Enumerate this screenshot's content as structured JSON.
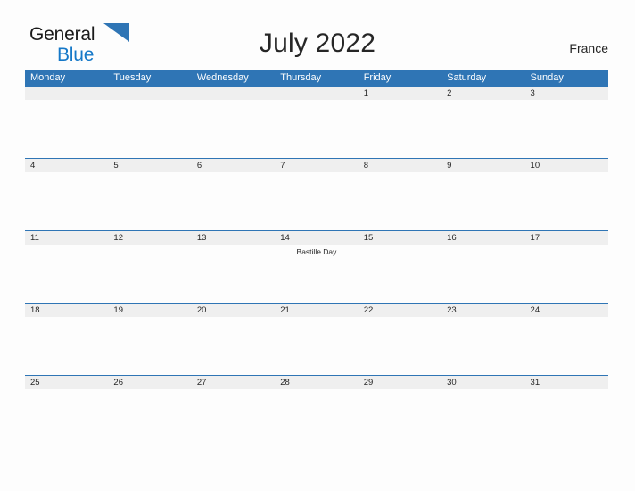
{
  "brand": {
    "word1": "General",
    "word2": "Blue",
    "flag_icon": "blue-triangle-flag-icon",
    "word1_color": "#1a1a1a",
    "word2_color": "#1578c8",
    "flag_color": "#2f75b5"
  },
  "header": {
    "title": "July 2022",
    "country": "France"
  },
  "colors": {
    "header_blue": "#2f75b5",
    "date_band_gray": "#efefef",
    "page_background": "#fdfdfd",
    "text_dark": "#262626"
  },
  "calendar": {
    "weekdays": [
      "Monday",
      "Tuesday",
      "Wednesday",
      "Thursday",
      "Friday",
      "Saturday",
      "Sunday"
    ],
    "weeks": [
      [
        {
          "date": "",
          "event": ""
        },
        {
          "date": "",
          "event": ""
        },
        {
          "date": "",
          "event": ""
        },
        {
          "date": "",
          "event": ""
        },
        {
          "date": "1",
          "event": ""
        },
        {
          "date": "2",
          "event": ""
        },
        {
          "date": "3",
          "event": ""
        }
      ],
      [
        {
          "date": "4",
          "event": ""
        },
        {
          "date": "5",
          "event": ""
        },
        {
          "date": "6",
          "event": ""
        },
        {
          "date": "7",
          "event": ""
        },
        {
          "date": "8",
          "event": ""
        },
        {
          "date": "9",
          "event": ""
        },
        {
          "date": "10",
          "event": ""
        }
      ],
      [
        {
          "date": "11",
          "event": ""
        },
        {
          "date": "12",
          "event": ""
        },
        {
          "date": "13",
          "event": ""
        },
        {
          "date": "14",
          "event": "Bastille Day"
        },
        {
          "date": "15",
          "event": ""
        },
        {
          "date": "16",
          "event": ""
        },
        {
          "date": "17",
          "event": ""
        }
      ],
      [
        {
          "date": "18",
          "event": ""
        },
        {
          "date": "19",
          "event": ""
        },
        {
          "date": "20",
          "event": ""
        },
        {
          "date": "21",
          "event": ""
        },
        {
          "date": "22",
          "event": ""
        },
        {
          "date": "23",
          "event": ""
        },
        {
          "date": "24",
          "event": ""
        }
      ],
      [
        {
          "date": "25",
          "event": ""
        },
        {
          "date": "26",
          "event": ""
        },
        {
          "date": "27",
          "event": ""
        },
        {
          "date": "28",
          "event": ""
        },
        {
          "date": "29",
          "event": ""
        },
        {
          "date": "30",
          "event": ""
        },
        {
          "date": "31",
          "event": ""
        }
      ]
    ]
  }
}
